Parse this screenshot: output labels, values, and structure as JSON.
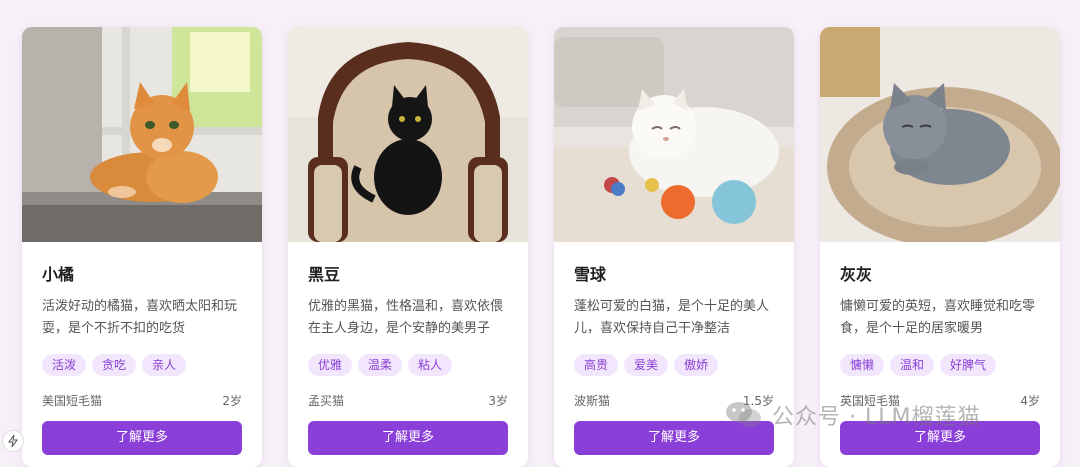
{
  "cards": [
    {
      "name": "小橘",
      "description": "活泼好动的橘猫，喜欢晒太阳和玩耍，是个不折不扣的吃货",
      "tags": [
        "活泼",
        "贪吃",
        "亲人"
      ],
      "breed": "美国短毛猫",
      "age": "2岁",
      "button": "了解更多",
      "photo": "orange-cat-on-windowsill"
    },
    {
      "name": "黑豆",
      "description": "优雅的黑猫，性格温和，喜欢依偎在主人身边，是个安静的美男子",
      "tags": [
        "优雅",
        "温柔",
        "粘人"
      ],
      "breed": "孟买猫",
      "age": "3岁",
      "button": "了解更多",
      "photo": "black-cat-on-armchair"
    },
    {
      "name": "雪球",
      "description": "蓬松可爱的白猫，是个十足的美人儿，喜欢保持自己干净整洁",
      "tags": [
        "高贵",
        "爱美",
        "傲娇"
      ],
      "breed": "波斯猫",
      "age": "1.5岁",
      "button": "了解更多",
      "photo": "white-cat-with-balls"
    },
    {
      "name": "灰灰",
      "description": "慵懒可爱的英短，喜欢睡觉和吃零食，是个十足的居家暖男",
      "tags": [
        "慵懒",
        "温和",
        "好脾气"
      ],
      "breed": "英国短毛猫",
      "age": "4岁",
      "button": "了解更多",
      "photo": "gray-cat-sleeping-in-bed"
    }
  ],
  "watermark": {
    "text": "公众号 · LLM榴莲猫",
    "icon": "wechat-icon"
  },
  "corner_icon": "lightning-icon",
  "colors": {
    "accent": "#8a3fd9",
    "tag_bg": "#f1e6fb",
    "tag_text": "#8b3fd6",
    "page_bg": "#f7f0f8"
  }
}
